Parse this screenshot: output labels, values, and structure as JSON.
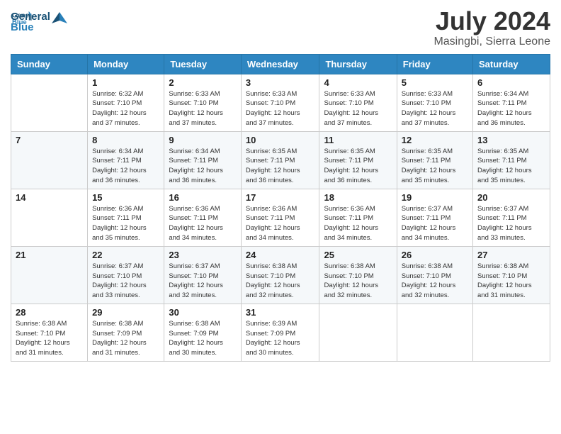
{
  "header": {
    "logo_line1": "General",
    "logo_line2": "Blue",
    "month": "July 2024",
    "location": "Masingbi, Sierra Leone"
  },
  "days_of_week": [
    "Sunday",
    "Monday",
    "Tuesday",
    "Wednesday",
    "Thursday",
    "Friday",
    "Saturday"
  ],
  "weeks": [
    [
      {
        "day": "",
        "info": ""
      },
      {
        "day": "1",
        "info": "Sunrise: 6:32 AM\nSunset: 7:10 PM\nDaylight: 12 hours\nand 37 minutes."
      },
      {
        "day": "2",
        "info": "Sunrise: 6:33 AM\nSunset: 7:10 PM\nDaylight: 12 hours\nand 37 minutes."
      },
      {
        "day": "3",
        "info": "Sunrise: 6:33 AM\nSunset: 7:10 PM\nDaylight: 12 hours\nand 37 minutes."
      },
      {
        "day": "4",
        "info": "Sunrise: 6:33 AM\nSunset: 7:10 PM\nDaylight: 12 hours\nand 37 minutes."
      },
      {
        "day": "5",
        "info": "Sunrise: 6:33 AM\nSunset: 7:10 PM\nDaylight: 12 hours\nand 37 minutes."
      },
      {
        "day": "6",
        "info": "Sunrise: 6:34 AM\nSunset: 7:11 PM\nDaylight: 12 hours\nand 36 minutes."
      }
    ],
    [
      {
        "day": "7",
        "info": ""
      },
      {
        "day": "8",
        "info": "Sunrise: 6:34 AM\nSunset: 7:11 PM\nDaylight: 12 hours\nand 36 minutes."
      },
      {
        "day": "9",
        "info": "Sunrise: 6:34 AM\nSunset: 7:11 PM\nDaylight: 12 hours\nand 36 minutes."
      },
      {
        "day": "10",
        "info": "Sunrise: 6:35 AM\nSunset: 7:11 PM\nDaylight: 12 hours\nand 36 minutes."
      },
      {
        "day": "11",
        "info": "Sunrise: 6:35 AM\nSunset: 7:11 PM\nDaylight: 12 hours\nand 36 minutes."
      },
      {
        "day": "12",
        "info": "Sunrise: 6:35 AM\nSunset: 7:11 PM\nDaylight: 12 hours\nand 35 minutes."
      },
      {
        "day": "13",
        "info": "Sunrise: 6:35 AM\nSunset: 7:11 PM\nDaylight: 12 hours\nand 35 minutes."
      }
    ],
    [
      {
        "day": "14",
        "info": ""
      },
      {
        "day": "15",
        "info": "Sunrise: 6:36 AM\nSunset: 7:11 PM\nDaylight: 12 hours\nand 35 minutes."
      },
      {
        "day": "16",
        "info": "Sunrise: 6:36 AM\nSunset: 7:11 PM\nDaylight: 12 hours\nand 34 minutes."
      },
      {
        "day": "17",
        "info": "Sunrise: 6:36 AM\nSunset: 7:11 PM\nDaylight: 12 hours\nand 34 minutes."
      },
      {
        "day": "18",
        "info": "Sunrise: 6:36 AM\nSunset: 7:11 PM\nDaylight: 12 hours\nand 34 minutes."
      },
      {
        "day": "19",
        "info": "Sunrise: 6:37 AM\nSunset: 7:11 PM\nDaylight: 12 hours\nand 34 minutes."
      },
      {
        "day": "20",
        "info": "Sunrise: 6:37 AM\nSunset: 7:11 PM\nDaylight: 12 hours\nand 33 minutes."
      }
    ],
    [
      {
        "day": "21",
        "info": ""
      },
      {
        "day": "22",
        "info": "Sunrise: 6:37 AM\nSunset: 7:10 PM\nDaylight: 12 hours\nand 33 minutes."
      },
      {
        "day": "23",
        "info": "Sunrise: 6:37 AM\nSunset: 7:10 PM\nDaylight: 12 hours\nand 32 minutes."
      },
      {
        "day": "24",
        "info": "Sunrise: 6:38 AM\nSunset: 7:10 PM\nDaylight: 12 hours\nand 32 minutes."
      },
      {
        "day": "25",
        "info": "Sunrise: 6:38 AM\nSunset: 7:10 PM\nDaylight: 12 hours\nand 32 minutes."
      },
      {
        "day": "26",
        "info": "Sunrise: 6:38 AM\nSunset: 7:10 PM\nDaylight: 12 hours\nand 32 minutes."
      },
      {
        "day": "27",
        "info": "Sunrise: 6:38 AM\nSunset: 7:10 PM\nDaylight: 12 hours\nand 31 minutes."
      }
    ],
    [
      {
        "day": "28",
        "info": "Sunrise: 6:38 AM\nSunset: 7:10 PM\nDaylight: 12 hours\nand 31 minutes."
      },
      {
        "day": "29",
        "info": "Sunrise: 6:38 AM\nSunset: 7:09 PM\nDaylight: 12 hours\nand 31 minutes."
      },
      {
        "day": "30",
        "info": "Sunrise: 6:38 AM\nSunset: 7:09 PM\nDaylight: 12 hours\nand 30 minutes."
      },
      {
        "day": "31",
        "info": "Sunrise: 6:39 AM\nSunset: 7:09 PM\nDaylight: 12 hours\nand 30 minutes."
      },
      {
        "day": "",
        "info": ""
      },
      {
        "day": "",
        "info": ""
      },
      {
        "day": "",
        "info": ""
      }
    ]
  ]
}
